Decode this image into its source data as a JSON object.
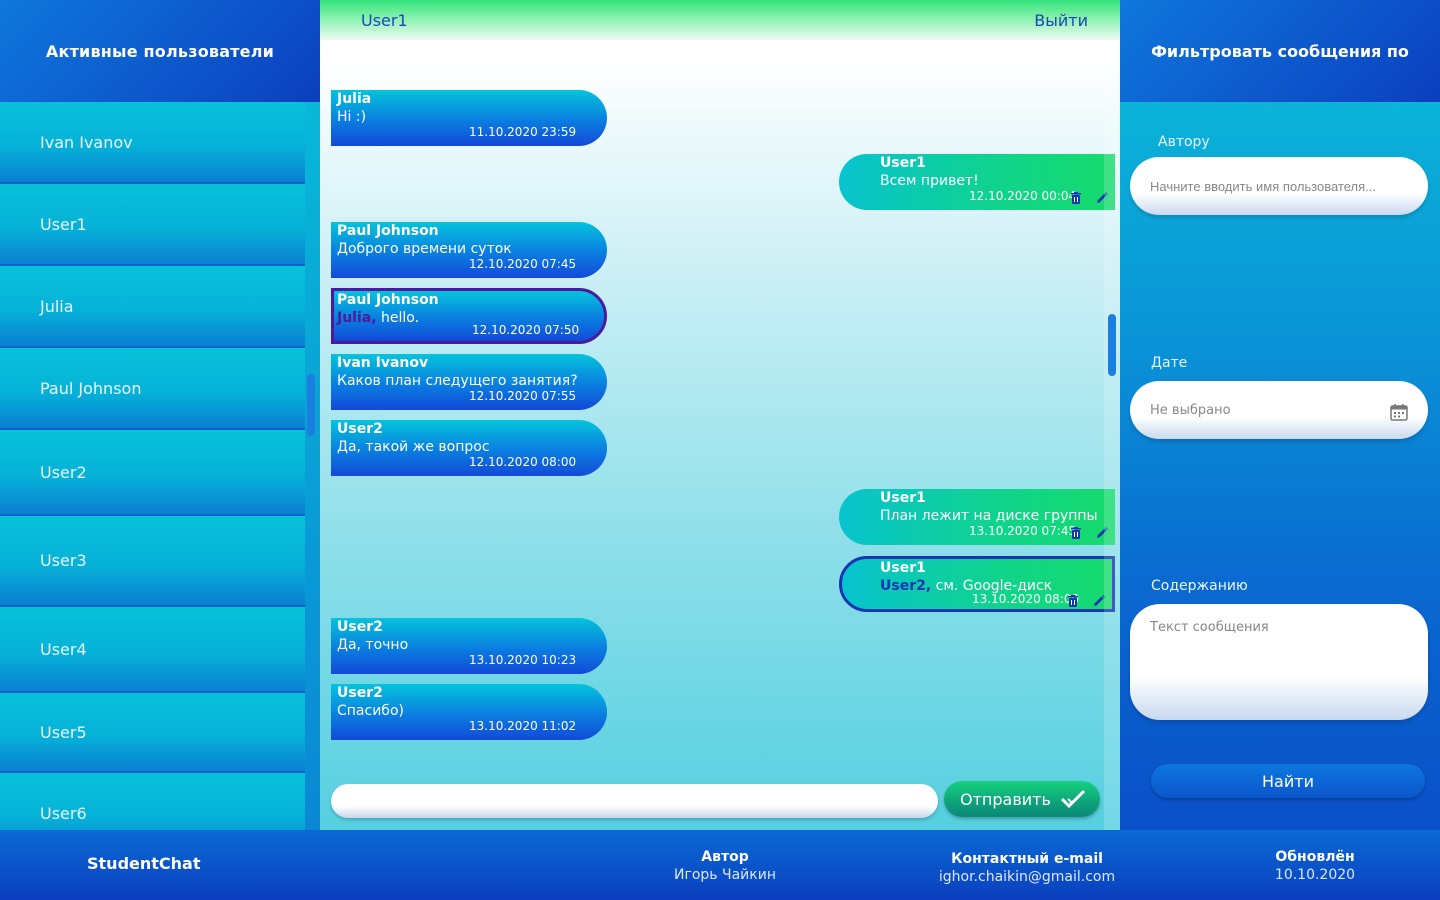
{
  "sidebar": {
    "title": "Активные пользователи",
    "users": [
      "Ivan Ivanov",
      "User1",
      "Julia",
      "Paul Johnson",
      "User2",
      "User3",
      "User4",
      "User5",
      "User6"
    ]
  },
  "chat": {
    "current_user": "User1",
    "logout_label": "Выйти",
    "messages": [
      {
        "author": "Julia",
        "text": "Hi :)",
        "time": "11.10.2020 23:59",
        "side": "in"
      },
      {
        "author": "User1",
        "text": "Всем привет!",
        "time": "12.10.2020 00:04",
        "side": "out"
      },
      {
        "author": "Paul Johnson",
        "text": "Доброго времени суток",
        "time": "12.10.2020 07:45",
        "side": "in"
      },
      {
        "author": "Paul Johnson",
        "mention": "Julia,",
        "text": " hello.",
        "time": "12.10.2020 07:50",
        "side": "in"
      },
      {
        "author": "Ivan Ivanov",
        "text": "Каков план следущего занятия?",
        "time": "12.10.2020 07:55",
        "side": "in"
      },
      {
        "author": "User2",
        "text": "Да, такой же вопрос",
        "time": "12.10.2020 08:00",
        "side": "in"
      },
      {
        "author": "User1",
        "text": "План лежит на диске группы",
        "time": "13.10.2020 07:45",
        "side": "out"
      },
      {
        "author": "User1",
        "mention": "User2,",
        "text": " см. Google-диск",
        "time": "13.10.2020 08:00",
        "side": "out"
      },
      {
        "author": "User2",
        "text": "Да, точно",
        "time": "13.10.2020 10:23",
        "side": "in"
      },
      {
        "author": "User2",
        "text": "Спасибо)",
        "time": "13.10.2020 11:02",
        "side": "in"
      }
    ],
    "composer_value": "",
    "send_label": "Отправить"
  },
  "filter": {
    "title": "Фильтровать сообщения по",
    "author_label": "Автору",
    "author_placeholder": "Начните вводить имя пользователя...",
    "date_label": "Дате",
    "date_value": "Не выбрано",
    "content_label": "Содержанию",
    "content_placeholder": "Текст сообщения",
    "find_label": "Найти"
  },
  "footer": {
    "brand": "StudentChat",
    "author_label": "Автор",
    "author_value": "Игорь Чайкин",
    "email_label": "Контактный e-mail",
    "email_value": "ighor.chaikin@gmail.com",
    "updated_label": "Обновлён",
    "updated_value": "10.10.2020"
  },
  "colors": {
    "accent_blue": "#0b3fbf",
    "cyan": "#08c1da",
    "green": "#16db6c",
    "mention_in": "#4b1a9e",
    "mention_out": "#1336b3"
  }
}
